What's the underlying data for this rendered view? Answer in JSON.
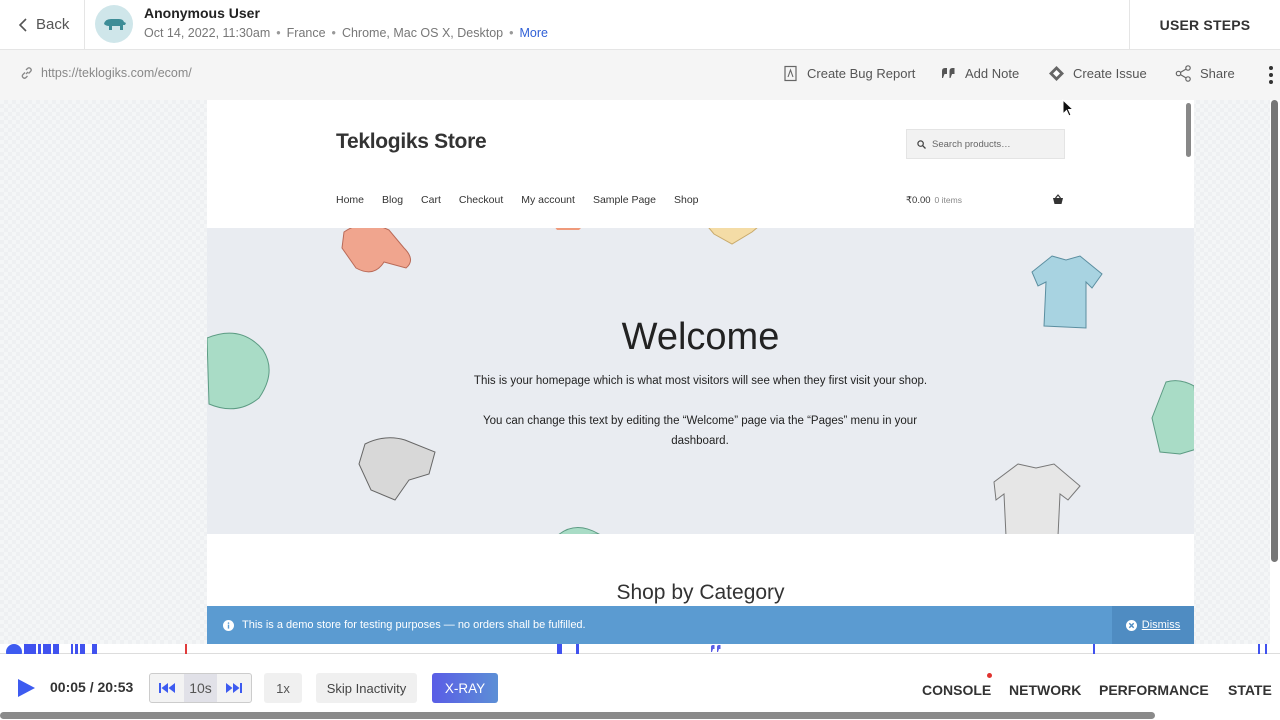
{
  "header": {
    "back_label": "Back",
    "user_name": "Anonymous User",
    "meta": {
      "datetime": "Oct 14, 2022, 11:30am",
      "country": "France",
      "env": "Chrome, Mac OS X, Desktop",
      "more": "More"
    },
    "user_steps": "USER STEPS"
  },
  "urlbar": {
    "url": "https://teklogiks.com/ecom/",
    "actions": {
      "bug_report": "Create Bug Report",
      "add_note": "Add Note",
      "create_issue": "Create Issue",
      "share": "Share"
    }
  },
  "site": {
    "store_title": "Teklogiks Store",
    "search_placeholder": "Search products…",
    "nav": [
      "Home",
      "Blog",
      "Cart",
      "Checkout",
      "My account",
      "Sample Page",
      "Shop"
    ],
    "cart_total": "₹0.00",
    "cart_items": "0 items",
    "hero": {
      "title": "Welcome",
      "p1": "This is your homepage which is what most visitors will see when they first visit your shop.",
      "p2": "You can change this text by editing the “Welcome” page via the “Pages” menu in your dashboard."
    },
    "section_title": "Shop by Category",
    "demo_notice": "This is a demo store for testing purposes — no orders shall be fulfilled.",
    "dismiss": "Dismiss"
  },
  "controls": {
    "time": "00:05 / 20:53",
    "skip_amount": "10s",
    "speed": "1x",
    "skip_inactivity": "Skip Inactivity",
    "xray": "X-RAY",
    "tabs": {
      "console": "CONSOLE",
      "network": "NETWORK",
      "performance": "PERFORMANCE",
      "state": "STATE"
    }
  },
  "colors": {
    "accent": "#3d5bf0",
    "demo_bar": "#5b9bd1",
    "hero_bg": "#e9ecf1",
    "error": "#e03b3b"
  }
}
